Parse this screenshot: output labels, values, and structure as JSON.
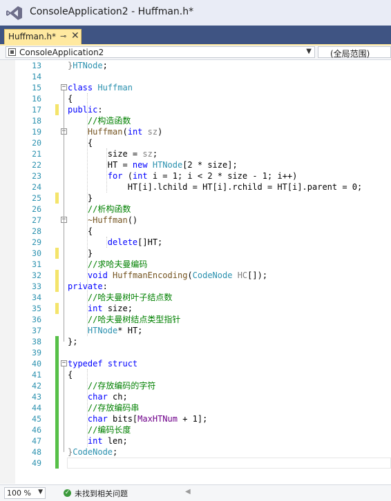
{
  "window": {
    "title": "ConsoleApplication2 - Huffman.h*"
  },
  "tab": {
    "label": "Huffman.h*",
    "pin_glyph": "⊸",
    "close_glyph": "✕"
  },
  "navbar": {
    "project": "ConsoleApplication2",
    "scope": "(全局范围)"
  },
  "status": {
    "zoom": "100 %",
    "message": "未找到相关问题"
  },
  "colors": {
    "keyword": "#0000ff",
    "type": "#2b91af",
    "comment": "#008000",
    "function": "#74531f",
    "changed_saved": "#57c048",
    "changed_unsaved": "#f4e46b",
    "tab_active": "#ffe9a0",
    "tab_strip": "#3f5483"
  },
  "icons": [
    "vs-logo-icon",
    "pin-icon",
    "close-icon",
    "scope-icon",
    "chevron-down-icon",
    "check-icon",
    "fold-minus-icon"
  ],
  "code_lines": [
    {
      "n": "13",
      "chg": "",
      "fold": "",
      "tokens": [
        {
          "c": "p",
          "t": "}"
        },
        {
          "c": "t",
          "t": "HTNode"
        },
        {
          "c": "",
          "t": ";"
        }
      ]
    },
    {
      "n": "14",
      "chg": "",
      "fold": "",
      "tokens": []
    },
    {
      "n": "15",
      "chg": "",
      "fold": "−",
      "tokens": [
        {
          "c": "k",
          "t": "class"
        },
        {
          "c": "",
          "t": " "
        },
        {
          "c": "t",
          "t": "Huffman"
        }
      ]
    },
    {
      "n": "16",
      "chg": "",
      "fold": "",
      "tokens": [
        {
          "c": "",
          "t": "{"
        }
      ]
    },
    {
      "n": "17",
      "chg": "y",
      "fold": "",
      "tokens": [
        {
          "c": "k",
          "t": "public"
        },
        {
          "c": "",
          "t": ":"
        }
      ]
    },
    {
      "n": "18",
      "chg": "",
      "fold": "",
      "tokens": [
        {
          "c": "",
          "t": "    "
        },
        {
          "c": "c",
          "t": "//构造函数"
        }
      ]
    },
    {
      "n": "19",
      "chg": "",
      "fold": "−",
      "tokens": [
        {
          "c": "",
          "t": "    "
        },
        {
          "c": "f",
          "t": "Huffman"
        },
        {
          "c": "",
          "t": "("
        },
        {
          "c": "k",
          "t": "int"
        },
        {
          "c": "",
          "t": " "
        },
        {
          "c": "p",
          "t": "sz"
        },
        {
          "c": "",
          "t": ")"
        }
      ]
    },
    {
      "n": "20",
      "chg": "",
      "fold": "",
      "tokens": [
        {
          "c": "",
          "t": "    {"
        }
      ]
    },
    {
      "n": "21",
      "chg": "",
      "fold": "",
      "tokens": [
        {
          "c": "",
          "t": "        size = "
        },
        {
          "c": "p",
          "t": "sz"
        },
        {
          "c": "",
          "t": ";"
        }
      ]
    },
    {
      "n": "22",
      "chg": "",
      "fold": "",
      "tokens": [
        {
          "c": "",
          "t": "        HT = "
        },
        {
          "c": "k",
          "t": "new"
        },
        {
          "c": "",
          "t": " "
        },
        {
          "c": "t",
          "t": "HTNode"
        },
        {
          "c": "",
          "t": "[2 * size];"
        }
      ]
    },
    {
      "n": "23",
      "chg": "",
      "fold": "",
      "tokens": [
        {
          "c": "",
          "t": "        "
        },
        {
          "c": "k",
          "t": "for"
        },
        {
          "c": "",
          "t": " ("
        },
        {
          "c": "k",
          "t": "int"
        },
        {
          "c": "",
          "t": " i = 1; i < 2 * size - 1; i++)"
        }
      ]
    },
    {
      "n": "24",
      "chg": "",
      "fold": "",
      "tokens": [
        {
          "c": "",
          "t": "            HT[i].lchild = HT[i].rchild = HT[i].parent = 0;"
        }
      ]
    },
    {
      "n": "25",
      "chg": "y",
      "fold": "",
      "tokens": [
        {
          "c": "",
          "t": "    }"
        }
      ]
    },
    {
      "n": "26",
      "chg": "",
      "fold": "",
      "tokens": [
        {
          "c": "",
          "t": "    "
        },
        {
          "c": "c",
          "t": "//析构函数"
        }
      ]
    },
    {
      "n": "27",
      "chg": "",
      "fold": "−",
      "tokens": [
        {
          "c": "",
          "t": "    "
        },
        {
          "c": "f",
          "t": "~Huffman"
        },
        {
          "c": "",
          "t": "()"
        }
      ]
    },
    {
      "n": "28",
      "chg": "",
      "fold": "",
      "tokens": [
        {
          "c": "",
          "t": "    {"
        }
      ]
    },
    {
      "n": "29",
      "chg": "",
      "fold": "",
      "tokens": [
        {
          "c": "",
          "t": "        "
        },
        {
          "c": "k",
          "t": "delete"
        },
        {
          "c": "",
          "t": "[]HT;"
        }
      ]
    },
    {
      "n": "30",
      "chg": "y",
      "fold": "",
      "tokens": [
        {
          "c": "",
          "t": "    }"
        }
      ]
    },
    {
      "n": "31",
      "chg": "",
      "fold": "",
      "tokens": [
        {
          "c": "",
          "t": "    "
        },
        {
          "c": "c",
          "t": "//求哈夫曼编码"
        }
      ]
    },
    {
      "n": "32",
      "chg": "y",
      "fold": "",
      "tokens": [
        {
          "c": "",
          "t": "    "
        },
        {
          "c": "k",
          "t": "void"
        },
        {
          "c": "",
          "t": " "
        },
        {
          "c": "f",
          "t": "HuffmanEncoding"
        },
        {
          "c": "",
          "t": "("
        },
        {
          "c": "t",
          "t": "CodeNode"
        },
        {
          "c": "",
          "t": " "
        },
        {
          "c": "p",
          "t": "HC"
        },
        {
          "c": "",
          "t": "[]);"
        }
      ]
    },
    {
      "n": "33",
      "chg": "y",
      "fold": "",
      "tokens": [
        {
          "c": "k",
          "t": "private"
        },
        {
          "c": "",
          "t": ":"
        }
      ]
    },
    {
      "n": "34",
      "chg": "",
      "fold": "",
      "tokens": [
        {
          "c": "",
          "t": "    "
        },
        {
          "c": "c",
          "t": "//哈夫曼树叶子结点数"
        }
      ]
    },
    {
      "n": "35",
      "chg": "y",
      "fold": "",
      "tokens": [
        {
          "c": "",
          "t": "    "
        },
        {
          "c": "k",
          "t": "int"
        },
        {
          "c": "",
          "t": " size;"
        }
      ]
    },
    {
      "n": "36",
      "chg": "",
      "fold": "",
      "tokens": [
        {
          "c": "",
          "t": "    "
        },
        {
          "c": "c",
          "t": "//哈夫曼树结点类型指针"
        }
      ]
    },
    {
      "n": "37",
      "chg": "",
      "fold": "",
      "tokens": [
        {
          "c": "",
          "t": "    "
        },
        {
          "c": "t",
          "t": "HTNode"
        },
        {
          "c": "",
          "t": "* HT;"
        }
      ]
    },
    {
      "n": "38",
      "chg": "g",
      "fold": "",
      "tokens": [
        {
          "c": "",
          "t": "};"
        }
      ]
    },
    {
      "n": "39",
      "chg": "g",
      "fold": "",
      "tokens": []
    },
    {
      "n": "40",
      "chg": "g",
      "fold": "−",
      "tokens": [
        {
          "c": "k",
          "t": "typedef"
        },
        {
          "c": "",
          "t": " "
        },
        {
          "c": "k",
          "t": "struct"
        }
      ]
    },
    {
      "n": "41",
      "chg": "g",
      "fold": "",
      "tokens": [
        {
          "c": "",
          "t": "{"
        }
      ]
    },
    {
      "n": "42",
      "chg": "g",
      "fold": "",
      "tokens": [
        {
          "c": "",
          "t": "    "
        },
        {
          "c": "c",
          "t": "//存放编码的字符"
        }
      ]
    },
    {
      "n": "43",
      "chg": "g",
      "fold": "",
      "tokens": [
        {
          "c": "",
          "t": "    "
        },
        {
          "c": "k",
          "t": "char"
        },
        {
          "c": "",
          "t": " ch;"
        }
      ]
    },
    {
      "n": "44",
      "chg": "g",
      "fold": "",
      "tokens": [
        {
          "c": "",
          "t": "    "
        },
        {
          "c": "c",
          "t": "//存放编码串"
        }
      ]
    },
    {
      "n": "45",
      "chg": "g",
      "fold": "",
      "tokens": [
        {
          "c": "",
          "t": "    "
        },
        {
          "c": "k",
          "t": "char"
        },
        {
          "c": "",
          "t": " bits["
        },
        {
          "c": "m",
          "t": "MaxHTNum"
        },
        {
          "c": "",
          "t": " + 1];"
        }
      ]
    },
    {
      "n": "46",
      "chg": "g",
      "fold": "",
      "tokens": [
        {
          "c": "",
          "t": "    "
        },
        {
          "c": "c",
          "t": "//编码长度"
        }
      ]
    },
    {
      "n": "47",
      "chg": "g",
      "fold": "",
      "tokens": [
        {
          "c": "",
          "t": "    "
        },
        {
          "c": "k",
          "t": "int"
        },
        {
          "c": "",
          "t": " len;"
        }
      ]
    },
    {
      "n": "48",
      "chg": "g",
      "fold": "",
      "tokens": [
        {
          "c": "p",
          "t": "}"
        },
        {
          "c": "t",
          "t": "CodeNode"
        },
        {
          "c": "",
          "t": ";"
        }
      ]
    },
    {
      "n": "49",
      "chg": "g",
      "fold": "",
      "tokens": []
    }
  ]
}
